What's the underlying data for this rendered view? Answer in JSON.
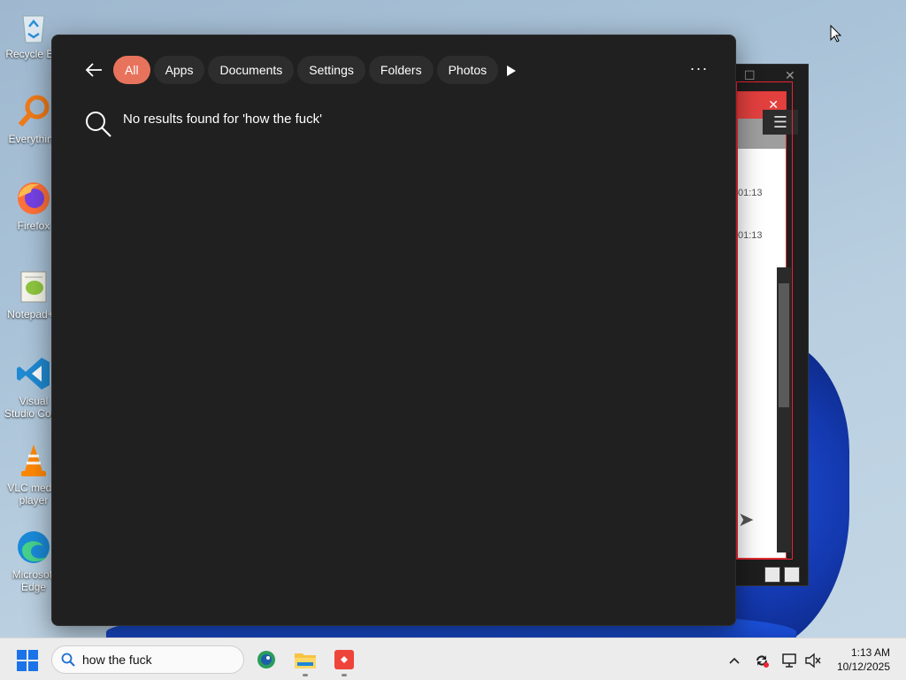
{
  "desktop": {
    "icons": [
      {
        "label": "Recycle Bin",
        "icon": "recycle-bin-icon"
      },
      {
        "label": "Everything",
        "icon": "everything-search-icon"
      },
      {
        "label": "Firefox",
        "icon": "firefox-icon"
      },
      {
        "label": "Notepad++",
        "icon": "notepad-plus-plus-icon"
      },
      {
        "label": "Visual Studio Code",
        "icon": "vscode-icon"
      },
      {
        "label": "VLC media player",
        "icon": "vlc-icon"
      },
      {
        "label": "Microsoft Edge",
        "icon": "edge-icon"
      }
    ]
  },
  "background_window": {
    "times": [
      "01:13",
      "01:13"
    ]
  },
  "search_flyout": {
    "filters": [
      "All",
      "Apps",
      "Documents",
      "Settings",
      "Folders",
      "Photos"
    ],
    "active_filter": "All",
    "no_results_text": "No results found for 'how the fuck'",
    "more_label": "···",
    "accent_color": "#e8735c"
  },
  "taskbar": {
    "search_value": "how the fuck",
    "apps": [
      "browser-app-icon",
      "file-explorer-icon",
      "anydesk-icon"
    ],
    "clock": {
      "time": "1:13 AM",
      "date": "10/12/2025"
    }
  }
}
